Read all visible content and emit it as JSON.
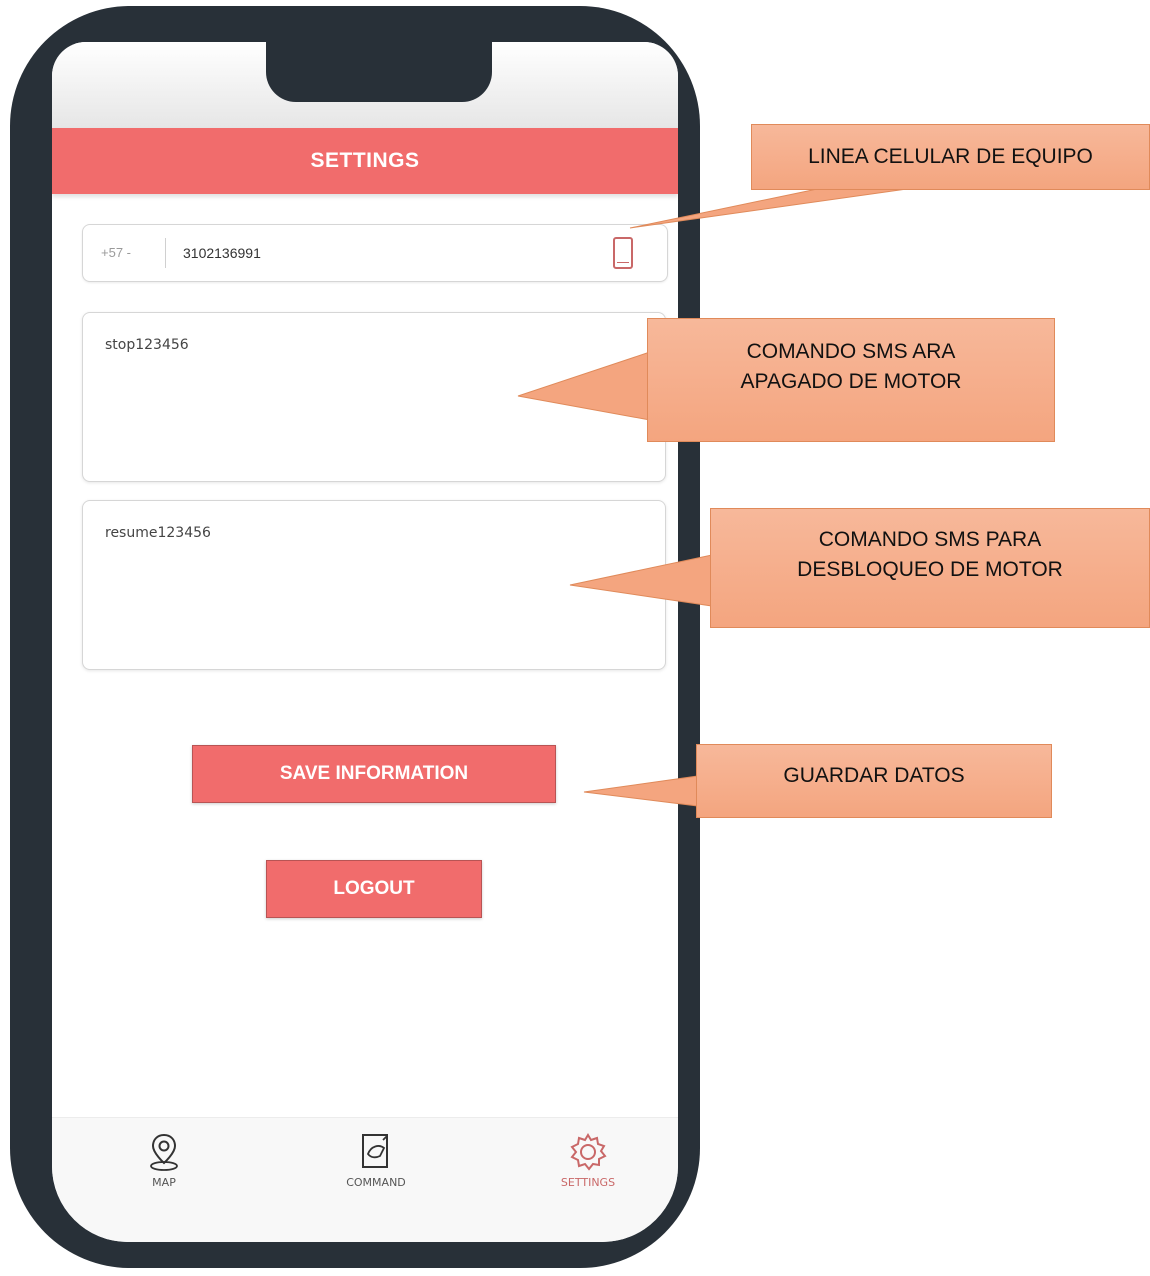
{
  "header": {
    "title": "SETTINGS"
  },
  "device_line": {
    "country_code": "+57 -",
    "number": "3102136991"
  },
  "commands": {
    "stop": "stop123456",
    "resume": "resume123456"
  },
  "buttons": {
    "save": "SAVE INFORMATION",
    "logout": "LOGOUT"
  },
  "tabs": [
    {
      "label": "MAP",
      "icon": "map-pin-icon"
    },
    {
      "label": "COMMAND",
      "icon": "command-icon"
    },
    {
      "label": "SETTINGS",
      "icon": "gear-icon",
      "active": true
    }
  ],
  "callouts": {
    "device_line": "LINEA CELULAR DE EQUIPO",
    "stop_cmd_line1": "COMANDO SMS ARA",
    "stop_cmd_line2": "APAGADO DE MOTOR",
    "resume_cmd_line1": "COMANDO SMS PARA",
    "resume_cmd_line2": "DESBLOQUEO DE MOTOR",
    "save": "GUARDAR DATOS"
  },
  "colors": {
    "accent": "#f16c6c",
    "phone_frame": "#283038",
    "callout_fill": "#f4a57f"
  }
}
